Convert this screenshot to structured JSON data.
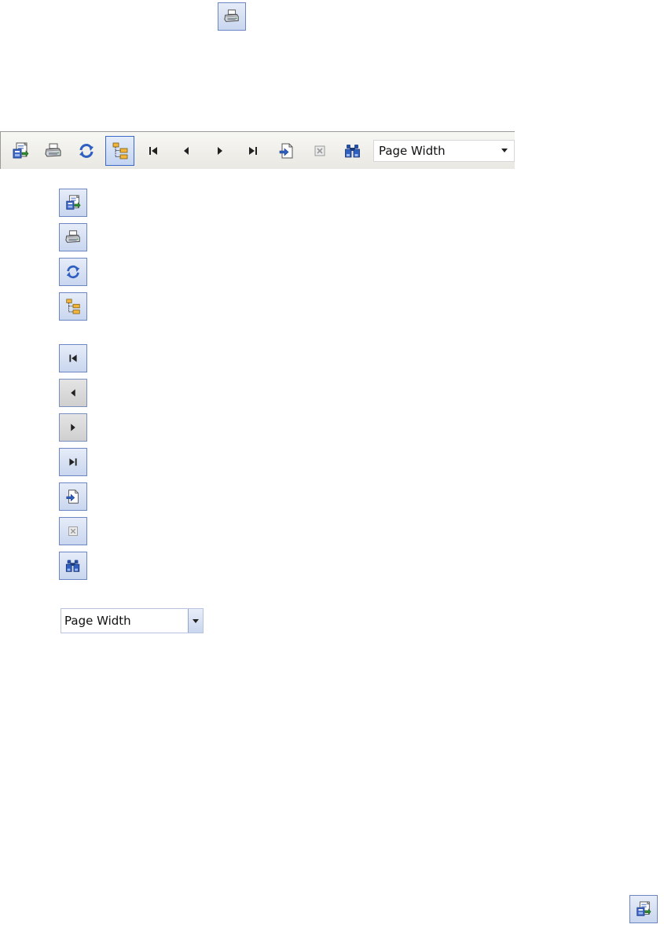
{
  "toolbar": {
    "buttons": [
      {
        "icon": "export-icon",
        "name": "export"
      },
      {
        "icon": "print-icon",
        "name": "print"
      },
      {
        "icon": "refresh-icon",
        "name": "refresh"
      },
      {
        "icon": "group-tree-icon",
        "name": "toggle-group-tree",
        "active": true
      },
      {
        "icon": "first-page-icon",
        "name": "first-page"
      },
      {
        "icon": "previous-page-icon",
        "name": "previous-page"
      },
      {
        "icon": "next-page-icon",
        "name": "next-page"
      },
      {
        "icon": "last-page-icon",
        "name": "last-page"
      },
      {
        "icon": "go-to-page-icon",
        "name": "go-to-page"
      },
      {
        "icon": "close-view-icon",
        "name": "close-view"
      },
      {
        "icon": "search-binoculars-icon",
        "name": "find"
      }
    ],
    "zoom": {
      "selected": "Page Width"
    }
  },
  "legend": {
    "zoom_selected": "Page Width"
  },
  "colors": {
    "button_border": "#6b86c2",
    "button_fill_top": "#e6ecf8",
    "button_fill_bottom": "#c9d6ef",
    "toolbar_bg": "#efeee9",
    "active_border": "#3a68c6"
  }
}
